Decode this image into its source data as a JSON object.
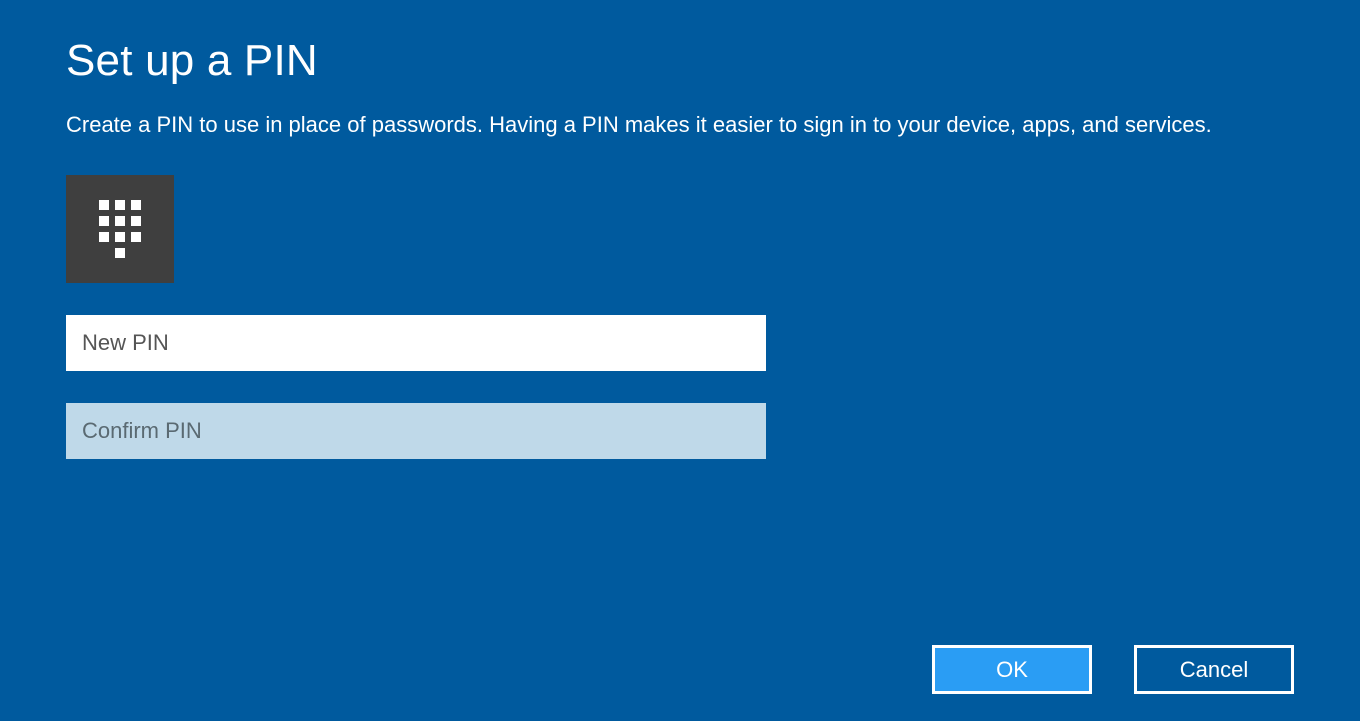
{
  "title": "Set up a PIN",
  "description": "Create a PIN to use in place of passwords. Having a PIN makes it easier to sign in to your device, apps, and services.",
  "icon": "keypad-icon",
  "fields": {
    "new_pin": {
      "placeholder": "New PIN",
      "value": ""
    },
    "confirm_pin": {
      "placeholder": "Confirm PIN",
      "value": ""
    }
  },
  "buttons": {
    "ok": "OK",
    "cancel": "Cancel"
  },
  "colors": {
    "background": "#005a9e",
    "icon_box": "#3f3f3f",
    "primary_button": "#2a9df4",
    "confirm_input_bg": "#bfd9e9"
  }
}
